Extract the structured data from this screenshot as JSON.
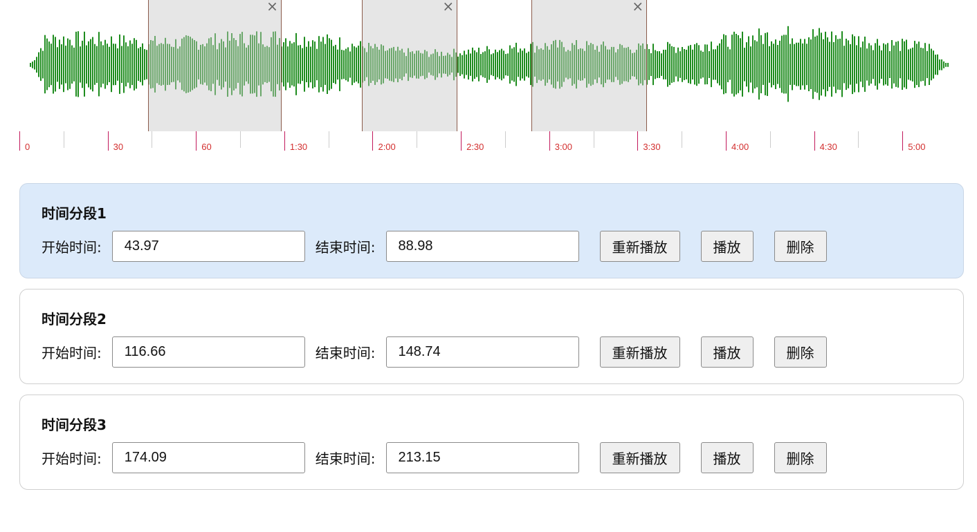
{
  "waveform": {
    "duration_seconds": 312,
    "color": "#1e8c1e",
    "regions": [
      {
        "start": 43.97,
        "end": 88.98,
        "close_icon": "×"
      },
      {
        "start": 116.66,
        "end": 148.74,
        "close_icon": "×"
      },
      {
        "start": 174.09,
        "end": 213.15,
        "close_icon": "×"
      }
    ]
  },
  "timeline": {
    "label_color": "#d32f2f",
    "labels": [
      "0",
      "30",
      "60",
      "1:30",
      "2:00",
      "2:30",
      "3:00",
      "3:30",
      "4:00",
      "4:30",
      "5:00"
    ]
  },
  "segments": [
    {
      "title": "时间分段1",
      "start_label": "开始时间:",
      "start_value": "43.97",
      "end_label": "结束时间:",
      "end_value": "88.98",
      "replay_label": "重新播放",
      "play_label": "播放",
      "delete_label": "删除",
      "active": true
    },
    {
      "title": "时间分段2",
      "start_label": "开始时间:",
      "start_value": "116.66",
      "end_label": "结束时间:",
      "end_value": "148.74",
      "replay_label": "重新播放",
      "play_label": "播放",
      "delete_label": "删除",
      "active": false
    },
    {
      "title": "时间分段3",
      "start_label": "开始时间:",
      "start_value": "174.09",
      "end_label": "结束时间:",
      "end_value": "213.15",
      "replay_label": "重新播放",
      "play_label": "播放",
      "delete_label": "删除",
      "active": false
    }
  ]
}
